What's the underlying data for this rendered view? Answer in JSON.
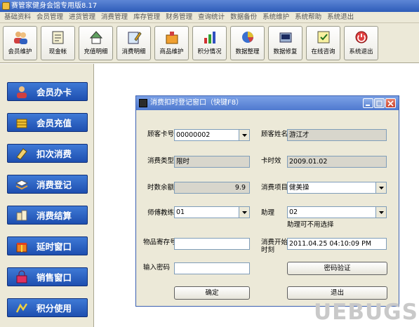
{
  "window": {
    "title": "赛管家健身会馆专用版8.17"
  },
  "menu": [
    "基础资料",
    "会员管理",
    "进货管理",
    "消费管理",
    "库存管理",
    "财务管理",
    "查询统计",
    "数据备份",
    "系统维护",
    "系统帮助",
    "系统退出"
  ],
  "toolbar": [
    {
      "label": "会员维护",
      "icon": "users-icon"
    },
    {
      "label": "现金帐",
      "icon": "cash-book-icon"
    },
    {
      "label": "充值明细",
      "icon": "recharge-icon"
    },
    {
      "label": "消费明细",
      "icon": "consume-detail-icon"
    },
    {
      "label": "商品维护",
      "icon": "goods-icon"
    },
    {
      "label": "积分情况",
      "icon": "points-chart-icon"
    },
    {
      "label": "数据整理",
      "icon": "data-pie-icon"
    },
    {
      "label": "数据修复",
      "icon": "data-repair-icon"
    },
    {
      "label": "在线咨询",
      "icon": "online-consult-icon"
    },
    {
      "label": "系统退出",
      "icon": "exit-icon"
    }
  ],
  "sidebar": [
    {
      "label": "会员办卡",
      "icon": "member-card-icon"
    },
    {
      "label": "会员充值",
      "icon": "coins-icon"
    },
    {
      "label": "扣次消费",
      "icon": "deduct-icon"
    },
    {
      "label": "消费登记",
      "icon": "register-icon"
    },
    {
      "label": "消费结算",
      "icon": "settle-icon"
    },
    {
      "label": "延时窗口",
      "icon": "gift-icon"
    },
    {
      "label": "销售窗口",
      "icon": "sales-icon"
    },
    {
      "label": "积分使用",
      "icon": "points-icon"
    }
  ],
  "dialog": {
    "title": "消费扣时登记窗口（快键F8）",
    "card_no_label": "顾客卡号",
    "card_no_value": "00000002",
    "name_label": "顾客姓名",
    "name_value": "游江才",
    "type_label": "消费类型",
    "type_value": "限时",
    "card_time_label": "卡时效",
    "card_time_value": "2009.01.02",
    "remain_label": "时数余额",
    "remain_value": "9.9",
    "project_label": "消费项目",
    "project_value": "健美操",
    "coach_label": "师傅教练",
    "coach_value": "01",
    "assist_label": "助理",
    "assist_value": "02",
    "assist_hint": "助理可不用选择",
    "locker_label": "物品寄存号",
    "locker_value": "",
    "start_label_1": "消费开始",
    "start_label_2": "时刻",
    "start_value": "2011.04.25 04:10:09 PM",
    "password_label": "输入密码",
    "password_value": "",
    "verify_button": "密码验证",
    "ok_button": "确定",
    "exit_button": "退出"
  },
  "watermark": "UEBUGS"
}
